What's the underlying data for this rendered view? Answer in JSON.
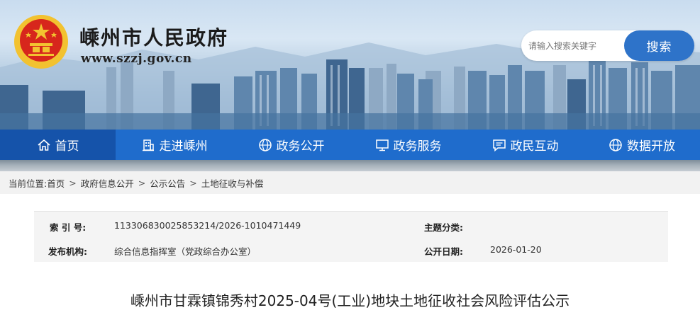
{
  "header": {
    "site_title": "嵊州市人民政府",
    "site_url": "www.szzj.gov.cn",
    "emblem_icon": "national-emblem-icon"
  },
  "search": {
    "placeholder": "请输入搜索关键字",
    "button_label": "搜索"
  },
  "nav": {
    "items": [
      {
        "label": "首页",
        "icon": "home-icon"
      },
      {
        "label": "走进嵊州",
        "icon": "building-icon"
      },
      {
        "label": "政务公开",
        "icon": "globe-icon"
      },
      {
        "label": "政务服务",
        "icon": "monitor-icon"
      },
      {
        "label": "政民互动",
        "icon": "message-icon"
      },
      {
        "label": "数据开放",
        "icon": "globe-icon"
      }
    ]
  },
  "breadcrumb": {
    "prefix": "当前位置:",
    "items": [
      "首页",
      "政府信息公开",
      "公示公告",
      "土地征收与补偿"
    ],
    "separator": ">"
  },
  "info": {
    "index_label": "索 引 号:",
    "index_value": "113306830025853214/2026-1010471449",
    "topic_label": "主题分类:",
    "topic_value": "",
    "publisher_label": "发布机构:",
    "publisher_value": "综合信息指挥室（党政综合办公室）",
    "date_label": "公开日期:",
    "date_value": "2026-01-20"
  },
  "article": {
    "title": "嵊州市甘霖镇锦秀村2025-04号(工业)地块土地征收社会风险评估公示"
  },
  "colors": {
    "nav_bg": "#1f6ccc",
    "nav_active": "#1553aa",
    "search_button": "#2e73c9",
    "emblem_red": "#d7261c",
    "emblem_gold": "#f2c230"
  }
}
